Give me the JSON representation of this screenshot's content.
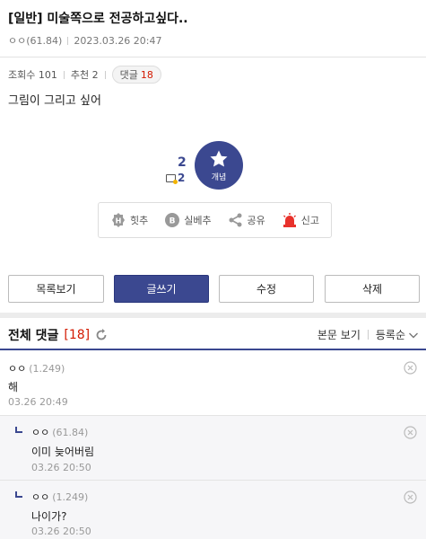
{
  "post": {
    "title": "[일반] 미술쪽으로 전공하고싶다..",
    "author": "ㅇㅇ(61.84)",
    "datetime": "2023.03.26 20:47",
    "views_label": "조회수 101",
    "recommend_label": "추천 2",
    "comment_label": "댓글",
    "comment_count": "18",
    "body": "그림이 그리고 싶어"
  },
  "recommend": {
    "count": "2",
    "fixed_count": "2",
    "button_label": "개념"
  },
  "actions": [
    {
      "label": "힛추",
      "icon": "hit-icon"
    },
    {
      "label": "실베추",
      "icon": "best-icon"
    },
    {
      "label": "공유",
      "icon": "share-icon"
    },
    {
      "label": "신고",
      "icon": "siren-icon"
    }
  ],
  "buttons": {
    "list": "목록보기",
    "write": "글쓰기",
    "edit": "수정",
    "delete": "삭제"
  },
  "comments_header": {
    "title": "전체 댓글",
    "count": "[18]",
    "view_body": "본문 보기",
    "sort": "등록순"
  },
  "comments": [
    {
      "nick": "ㅇㅇ",
      "ip": "(1.249)",
      "text": "해",
      "date": "03.26 20:49",
      "reply": false
    },
    {
      "nick": "ㅇㅇ",
      "ip": "(61.84)",
      "text": "이미 늦어버림",
      "date": "03.26 20:50",
      "reply": true
    },
    {
      "nick": "ㅇㅇ",
      "ip": "(1.249)",
      "text": "나이가?",
      "date": "03.26 20:50",
      "reply": true
    }
  ],
  "colors": {
    "accent": "#3b4890",
    "count_red": "#d31900"
  }
}
